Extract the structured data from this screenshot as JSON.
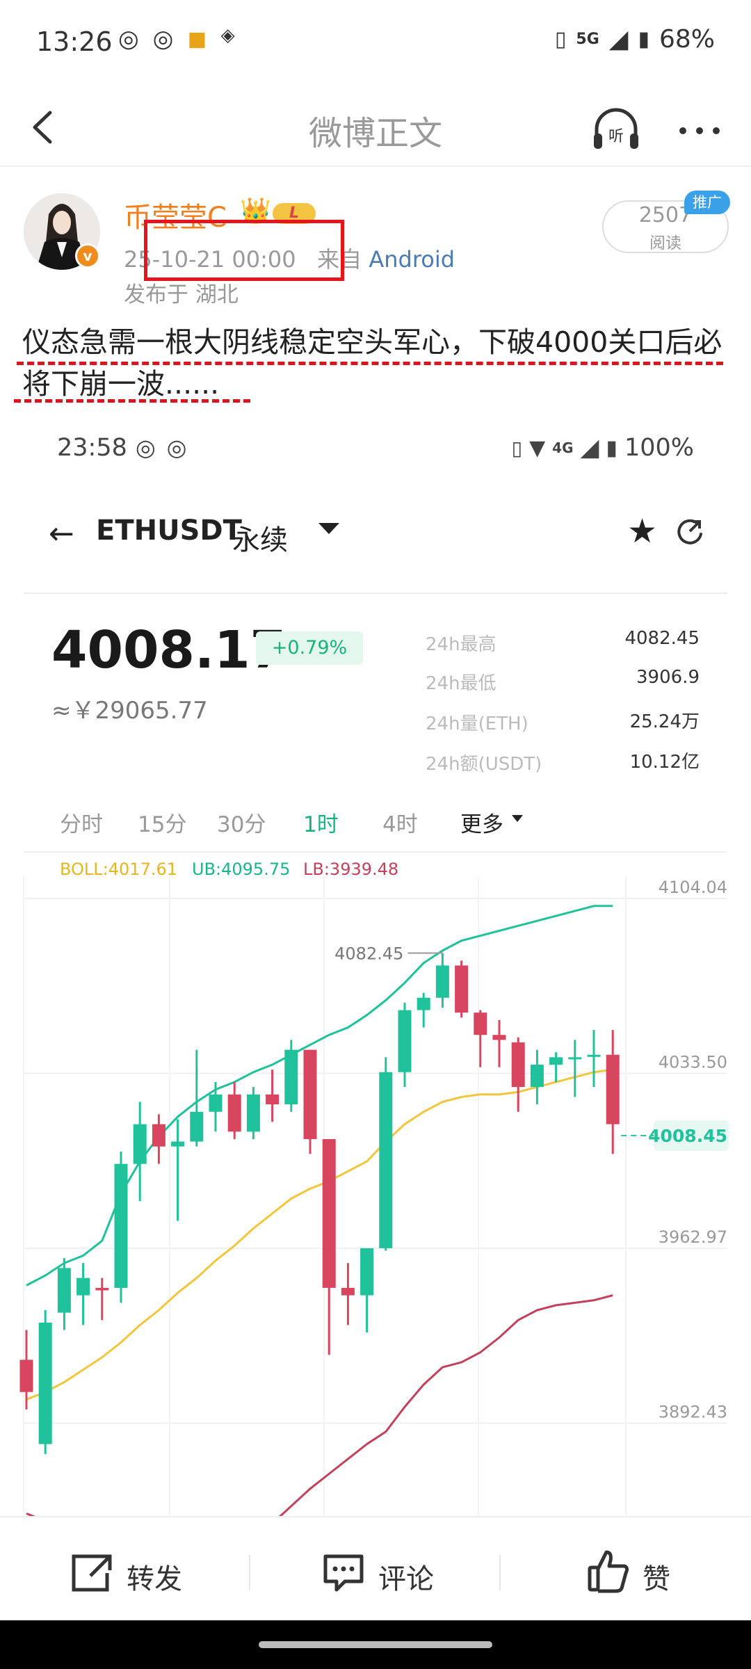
{
  "status_bar": {
    "time": "13:26",
    "left_icons": [
      "weibo-icon",
      "weibo-icon",
      "binance-icon",
      "diamond-app-icon"
    ],
    "network": "5G",
    "battery": "68%"
  },
  "nav": {
    "title": "微博正文",
    "listen_label": "听"
  },
  "post": {
    "author": "币莹莹C",
    "verified_badge": "v",
    "level_badge": "L",
    "timestamp": "25-10-21 00:00",
    "source_prefix": "来自",
    "source": "Android",
    "location": "发布于 湖北",
    "read_count": "2507",
    "read_label": "阅读",
    "promo_tag": "推广",
    "text": "仪态急需一根大阴线稳定空头军心，下破4000关口后必将下崩一波......"
  },
  "embedded": {
    "status_time": "23:58",
    "status_network": "4G",
    "status_battery": "100%",
    "back_arrow": "←",
    "symbol": "ETHUSDT",
    "contract_type": "永续",
    "price": "4008.17",
    "change_pct": "+0.79%",
    "price_cny": "≈￥29065.77",
    "stats": [
      {
        "label": "24h最高",
        "value": "4082.45"
      },
      {
        "label": "24h最低",
        "value": "3906.9"
      },
      {
        "label": "24h量(ETH)",
        "value": "25.24万"
      },
      {
        "label": "24h额(USDT)",
        "value": "10.12亿"
      }
    ],
    "timeframes": [
      "分时",
      "15分",
      "30分",
      "1时",
      "4时",
      "更多"
    ],
    "active_timeframe": "1时",
    "boll": {
      "boll_label": "BOLL:4017.61",
      "ub_label": "UB:4095.75",
      "lb_label": "LB:3939.48"
    },
    "colors": {
      "up": "#1fc29a",
      "down": "#d8455e",
      "mid": "#f2c53c",
      "ub": "#1ec29a",
      "lb": "#c2405a"
    }
  },
  "chart_data": {
    "type": "candlestick",
    "y_ticks": [
      "4104.04",
      "4033.50",
      "3962.97",
      "3892.43"
    ],
    "ylim": [
      3855,
      4113
    ],
    "current_price_label": "4008.45",
    "high_annotation": "4082.45",
    "candles": [
      {
        "o": 3918,
        "h": 3930,
        "l": 3898,
        "c": 3905
      },
      {
        "o": 3884,
        "h": 3938,
        "l": 3880,
        "c": 3933
      },
      {
        "o": 3937,
        "h": 3959,
        "l": 3930,
        "c": 3955
      },
      {
        "o": 3944,
        "h": 3957,
        "l": 3932,
        "c": 3951
      },
      {
        "o": 3947,
        "h": 3951,
        "l": 3934,
        "c": 3946
      },
      {
        "o": 3947,
        "h": 4002,
        "l": 3941,
        "c": 3997
      },
      {
        "o": 3997,
        "h": 4022,
        "l": 3982,
        "c": 4013
      },
      {
        "o": 4013,
        "h": 4017,
        "l": 3997,
        "c": 4004
      },
      {
        "o": 4004,
        "h": 4015,
        "l": 3974,
        "c": 4006
      },
      {
        "o": 4006,
        "h": 4043,
        "l": 4004,
        "c": 4018
      },
      {
        "o": 4018,
        "h": 4030,
        "l": 4010,
        "c": 4025
      },
      {
        "o": 4025,
        "h": 4030,
        "l": 4007,
        "c": 4010
      },
      {
        "o": 4010,
        "h": 4028,
        "l": 4007,
        "c": 4025
      },
      {
        "o": 4025,
        "h": 4035,
        "l": 4014,
        "c": 4021
      },
      {
        "o": 4021,
        "h": 4047,
        "l": 4018,
        "c": 4043
      },
      {
        "o": 4043,
        "h": 4043,
        "l": 4001,
        "c": 4007
      },
      {
        "o": 4007,
        "h": 4007,
        "l": 3920,
        "c": 3947
      },
      {
        "o": 3947,
        "h": 3957,
        "l": 3932,
        "c": 3944
      },
      {
        "o": 3944,
        "h": 3962,
        "l": 3929,
        "c": 3963
      },
      {
        "o": 3963,
        "h": 4040,
        "l": 3962,
        "c": 4034
      },
      {
        "o": 4034,
        "h": 4062,
        "l": 4028,
        "c": 4059
      },
      {
        "o": 4059,
        "h": 4066,
        "l": 4052,
        "c": 4064
      },
      {
        "o": 4064,
        "h": 4082,
        "l": 4060,
        "c": 4077
      },
      {
        "o": 4077,
        "h": 4079,
        "l": 4056,
        "c": 4058
      },
      {
        "o": 4058,
        "h": 4059,
        "l": 4036,
        "c": 4049
      },
      {
        "o": 4049,
        "h": 4055,
        "l": 4036,
        "c": 4047
      },
      {
        "o": 4046,
        "h": 4048,
        "l": 4018,
        "c": 4028
      },
      {
        "o": 4028,
        "h": 4043,
        "l": 4021,
        "c": 4037
      },
      {
        "o": 4037,
        "h": 4042,
        "l": 4030,
        "c": 4040
      },
      {
        "o": 4040,
        "h": 4047,
        "l": 4024,
        "c": 4040
      },
      {
        "o": 4041,
        "h": 4051,
        "l": 4028,
        "c": 4041
      },
      {
        "o": 4041,
        "h": 4051,
        "l": 4001,
        "c": 4013
      }
    ],
    "boll_mid": [
      3902,
      3905,
      3909,
      3914,
      3919,
      3925,
      3932,
      3938,
      3945,
      3951,
      3958,
      3964,
      3971,
      3977,
      3983,
      3987,
      3990,
      3994,
      3998,
      4006,
      4013,
      4018,
      4022,
      4024,
      4025,
      4025,
      4026,
      4028,
      4030,
      4032,
      4034,
      4035
    ],
    "boll_upper": [
      3948,
      3952,
      3957,
      3960,
      3966,
      3985,
      3998,
      4008,
      4016,
      4022,
      4027,
      4030,
      4034,
      4037,
      4041,
      4045,
      4049,
      4052,
      4057,
      4063,
      4070,
      4078,
      4083,
      4087,
      4089,
      4091,
      4093,
      4095,
      4097,
      4099,
      4101,
      4101
    ],
    "boll_lower": [
      3856,
      3853,
      3849,
      3844,
      3838,
      3834,
      3830,
      3828,
      3826,
      3829,
      3834,
      3840,
      3846,
      3852,
      3859,
      3866,
      3872,
      3878,
      3884,
      3889,
      3899,
      3908,
      3915,
      3917,
      3921,
      3927,
      3934,
      3938,
      3940,
      3941,
      3942,
      3944
    ]
  },
  "actions": {
    "repost": "转发",
    "comment": "评论",
    "like": "赞"
  }
}
